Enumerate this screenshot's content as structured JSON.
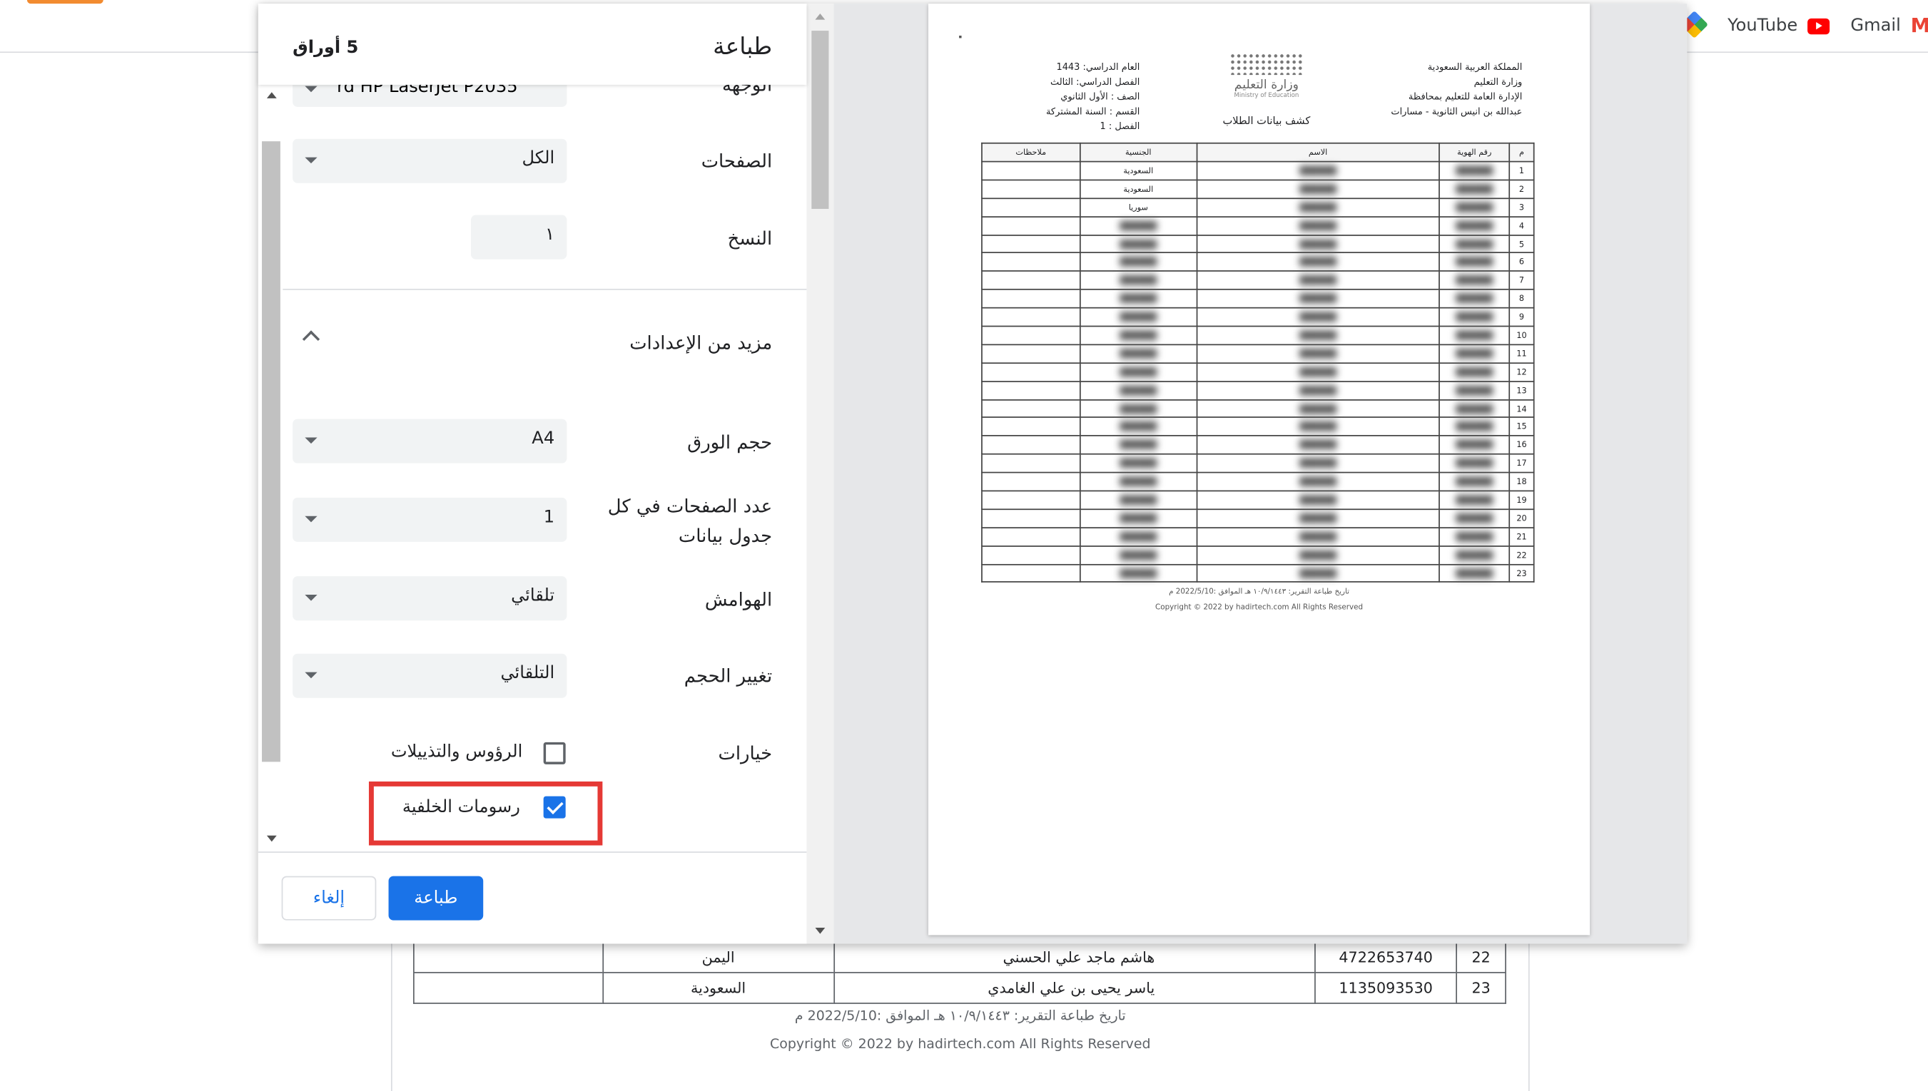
{
  "bookmarks": {
    "youtube": "YouTube",
    "gmail": "Gmail"
  },
  "colors": {
    "accent": "#1a73e8",
    "highlight_box": "#e53935"
  },
  "underlying_page": {
    "rows": [
      {
        "num": "22",
        "id": "4722653740",
        "name": "هاشم ماجد علي الحسني",
        "nationality": "اليمن",
        "notes": ""
      },
      {
        "num": "23",
        "id": "1135093530",
        "name": "ياسر يحيى بن علي الغامدي",
        "nationality": "السعودية",
        "notes": ""
      }
    ],
    "footer_date": "تاريخ طباعة التقرير: ١٠/٩/١٤٤٣ هـ الموافق :2022/5/10 م",
    "footer_copyright": "Copyright © 2022 by hadirtech.com All Rights Reserved"
  },
  "print_dialog": {
    "title": "طباعة",
    "sheets": "5 أوراق",
    "destination_partial": "rd HP LaserJet P2035",
    "destination_label": "الوجهة",
    "pages_label": "الصفحات",
    "pages_value": "الكل",
    "copies_label": "النسخ",
    "copies_value": "١",
    "more_settings_label": "مزيد من الإعدادات",
    "paper_size_label": "حجم الورق",
    "paper_size_value": "A4",
    "pages_per_sheet_label": "عدد الصفحات في كل جدول بيانات",
    "pages_per_sheet_value": "1",
    "margins_label": "الهوامش",
    "margins_value": "تلقائي",
    "scale_label": "تغيير الحجم",
    "scale_value": "التلقائي",
    "options_label": "خيارات",
    "option_headers_footers": "الرؤوس والتذييلات",
    "option_headers_footers_checked": false,
    "option_background_graphics": "رسومات الخلفية",
    "option_background_graphics_checked": true,
    "print_button": "طباعة",
    "cancel_button": "إلغاء"
  },
  "preview_doc": {
    "header_right": [
      "المملكة العربية السعودية",
      "وزارة التعليم",
      "الإدارة العامة للتعليم بمحافظة",
      "عبدالله بن انيس الثانوية - مسارات"
    ],
    "header_left": [
      "العام الدراسي: 1443",
      "الفصل الدراسي: الثالث",
      "الصف : الأول الثانوي",
      "القسم : السنة المشتركة",
      "الفصل : 1"
    ],
    "moe_ar": "وزارة التعليم",
    "moe_en": "Ministry of Education",
    "doc_title": "كشف بيانات الطلاب",
    "columns": [
      "م",
      "رقم الهوية",
      "الاسم",
      "الجنسية",
      "ملاحظات"
    ],
    "row_numbers": [
      "1",
      "2",
      "3",
      "4",
      "5",
      "6",
      "7",
      "8",
      "9",
      "10",
      "11",
      "12",
      "13",
      "14",
      "15",
      "16",
      "17",
      "18",
      "19",
      "20",
      "21",
      "22",
      "23"
    ],
    "visible_nationalities": [
      "السعودية",
      "السعودية",
      "سوريا"
    ],
    "footer_date": "تاريخ طباعة التقرير: ١٠/٩/١٤٤٣ هـ الموافق :2022/5/10 م",
    "footer_copyright": "Copyright © 2022 by hadirtech.com All Rights Reserved"
  }
}
